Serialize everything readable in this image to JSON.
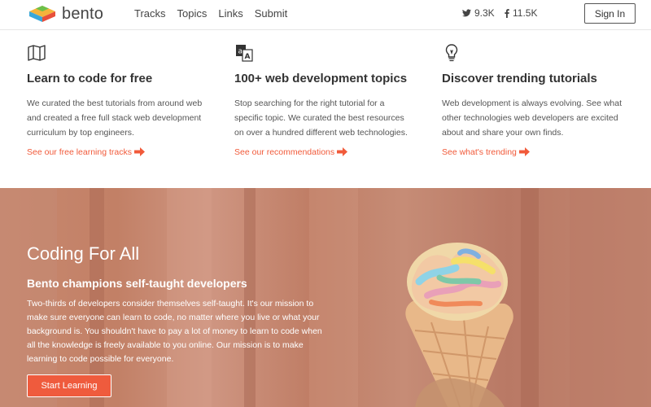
{
  "header": {
    "logo_text": "bento",
    "nav": [
      "Tracks",
      "Topics",
      "Links",
      "Submit"
    ],
    "twitter_count": "9.3K",
    "facebook_count": "11.5K",
    "signin_label": "Sign In"
  },
  "features": [
    {
      "icon": "map-icon",
      "title": "Learn to code for free",
      "body": "We curated the best tutorials from around web and created a free full stack web development curriculum by top engineers.",
      "link": "See our free learning tracks"
    },
    {
      "icon": "translate-icon",
      "title": "100+ web development topics",
      "body": "Stop searching for the right tutorial for a specific topic. We curated the best resources on over a hundred different web technologies.",
      "link": "See our recommendations"
    },
    {
      "icon": "lightbulb-icon",
      "title": "Discover trending tutorials",
      "body": "Web development is always evolving. See what other technologies web developers are excited about and share your own finds.",
      "link": "See what's trending"
    }
  ],
  "hero": {
    "title": "Coding For All",
    "subtitle": "Bento champions self-taught developers",
    "body": "Two-thirds of developers consider themselves self-taught. It's our mission to make sure everyone can learn to code, no matter where you live or what your background is. You shouldn't have to pay a lot of money to learn to code when all the knowledge is freely available to you online. Our mission is to make learning to code possible for everyone.",
    "button_label": "Start Learning"
  },
  "colors": {
    "accent": "#f15a3a",
    "hero_bg": "#c68670"
  }
}
